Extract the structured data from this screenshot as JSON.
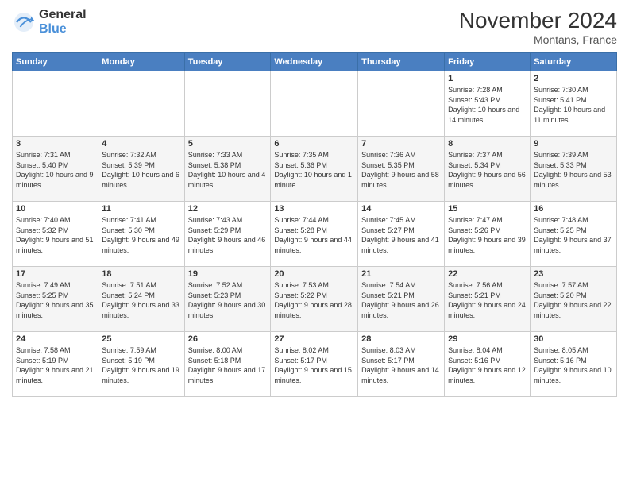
{
  "header": {
    "logo": {
      "general": "General",
      "blue": "Blue"
    },
    "title": "November 2024",
    "location": "Montans, France"
  },
  "days_of_week": [
    "Sunday",
    "Monday",
    "Tuesday",
    "Wednesday",
    "Thursday",
    "Friday",
    "Saturday"
  ],
  "weeks": [
    [
      null,
      null,
      null,
      null,
      null,
      {
        "day": "1",
        "sunrise": "Sunrise: 7:28 AM",
        "sunset": "Sunset: 5:43 PM",
        "daylight": "Daylight: 10 hours and 14 minutes."
      },
      {
        "day": "2",
        "sunrise": "Sunrise: 7:30 AM",
        "sunset": "Sunset: 5:41 PM",
        "daylight": "Daylight: 10 hours and 11 minutes."
      }
    ],
    [
      {
        "day": "3",
        "sunrise": "Sunrise: 7:31 AM",
        "sunset": "Sunset: 5:40 PM",
        "daylight": "Daylight: 10 hours and 9 minutes."
      },
      {
        "day": "4",
        "sunrise": "Sunrise: 7:32 AM",
        "sunset": "Sunset: 5:39 PM",
        "daylight": "Daylight: 10 hours and 6 minutes."
      },
      {
        "day": "5",
        "sunrise": "Sunrise: 7:33 AM",
        "sunset": "Sunset: 5:38 PM",
        "daylight": "Daylight: 10 hours and 4 minutes."
      },
      {
        "day": "6",
        "sunrise": "Sunrise: 7:35 AM",
        "sunset": "Sunset: 5:36 PM",
        "daylight": "Daylight: 10 hours and 1 minute."
      },
      {
        "day": "7",
        "sunrise": "Sunrise: 7:36 AM",
        "sunset": "Sunset: 5:35 PM",
        "daylight": "Daylight: 9 hours and 58 minutes."
      },
      {
        "day": "8",
        "sunrise": "Sunrise: 7:37 AM",
        "sunset": "Sunset: 5:34 PM",
        "daylight": "Daylight: 9 hours and 56 minutes."
      },
      {
        "day": "9",
        "sunrise": "Sunrise: 7:39 AM",
        "sunset": "Sunset: 5:33 PM",
        "daylight": "Daylight: 9 hours and 53 minutes."
      }
    ],
    [
      {
        "day": "10",
        "sunrise": "Sunrise: 7:40 AM",
        "sunset": "Sunset: 5:32 PM",
        "daylight": "Daylight: 9 hours and 51 minutes."
      },
      {
        "day": "11",
        "sunrise": "Sunrise: 7:41 AM",
        "sunset": "Sunset: 5:30 PM",
        "daylight": "Daylight: 9 hours and 49 minutes."
      },
      {
        "day": "12",
        "sunrise": "Sunrise: 7:43 AM",
        "sunset": "Sunset: 5:29 PM",
        "daylight": "Daylight: 9 hours and 46 minutes."
      },
      {
        "day": "13",
        "sunrise": "Sunrise: 7:44 AM",
        "sunset": "Sunset: 5:28 PM",
        "daylight": "Daylight: 9 hours and 44 minutes."
      },
      {
        "day": "14",
        "sunrise": "Sunrise: 7:45 AM",
        "sunset": "Sunset: 5:27 PM",
        "daylight": "Daylight: 9 hours and 41 minutes."
      },
      {
        "day": "15",
        "sunrise": "Sunrise: 7:47 AM",
        "sunset": "Sunset: 5:26 PM",
        "daylight": "Daylight: 9 hours and 39 minutes."
      },
      {
        "day": "16",
        "sunrise": "Sunrise: 7:48 AM",
        "sunset": "Sunset: 5:25 PM",
        "daylight": "Daylight: 9 hours and 37 minutes."
      }
    ],
    [
      {
        "day": "17",
        "sunrise": "Sunrise: 7:49 AM",
        "sunset": "Sunset: 5:25 PM",
        "daylight": "Daylight: 9 hours and 35 minutes."
      },
      {
        "day": "18",
        "sunrise": "Sunrise: 7:51 AM",
        "sunset": "Sunset: 5:24 PM",
        "daylight": "Daylight: 9 hours and 33 minutes."
      },
      {
        "day": "19",
        "sunrise": "Sunrise: 7:52 AM",
        "sunset": "Sunset: 5:23 PM",
        "daylight": "Daylight: 9 hours and 30 minutes."
      },
      {
        "day": "20",
        "sunrise": "Sunrise: 7:53 AM",
        "sunset": "Sunset: 5:22 PM",
        "daylight": "Daylight: 9 hours and 28 minutes."
      },
      {
        "day": "21",
        "sunrise": "Sunrise: 7:54 AM",
        "sunset": "Sunset: 5:21 PM",
        "daylight": "Daylight: 9 hours and 26 minutes."
      },
      {
        "day": "22",
        "sunrise": "Sunrise: 7:56 AM",
        "sunset": "Sunset: 5:21 PM",
        "daylight": "Daylight: 9 hours and 24 minutes."
      },
      {
        "day": "23",
        "sunrise": "Sunrise: 7:57 AM",
        "sunset": "Sunset: 5:20 PM",
        "daylight": "Daylight: 9 hours and 22 minutes."
      }
    ],
    [
      {
        "day": "24",
        "sunrise": "Sunrise: 7:58 AM",
        "sunset": "Sunset: 5:19 PM",
        "daylight": "Daylight: 9 hours and 21 minutes."
      },
      {
        "day": "25",
        "sunrise": "Sunrise: 7:59 AM",
        "sunset": "Sunset: 5:19 PM",
        "daylight": "Daylight: 9 hours and 19 minutes."
      },
      {
        "day": "26",
        "sunrise": "Sunrise: 8:00 AM",
        "sunset": "Sunset: 5:18 PM",
        "daylight": "Daylight: 9 hours and 17 minutes."
      },
      {
        "day": "27",
        "sunrise": "Sunrise: 8:02 AM",
        "sunset": "Sunset: 5:17 PM",
        "daylight": "Daylight: 9 hours and 15 minutes."
      },
      {
        "day": "28",
        "sunrise": "Sunrise: 8:03 AM",
        "sunset": "Sunset: 5:17 PM",
        "daylight": "Daylight: 9 hours and 14 minutes."
      },
      {
        "day": "29",
        "sunrise": "Sunrise: 8:04 AM",
        "sunset": "Sunset: 5:16 PM",
        "daylight": "Daylight: 9 hours and 12 minutes."
      },
      {
        "day": "30",
        "sunrise": "Sunrise: 8:05 AM",
        "sunset": "Sunset: 5:16 PM",
        "daylight": "Daylight: 9 hours and 10 minutes."
      }
    ]
  ]
}
